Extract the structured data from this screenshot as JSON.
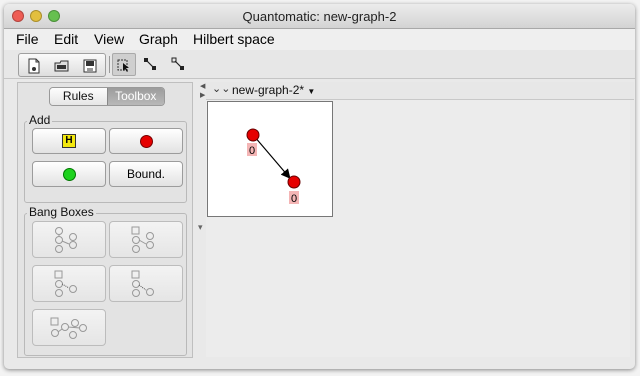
{
  "window": {
    "title": "Quantomatic: new-graph-2"
  },
  "menu": [
    "File",
    "Edit",
    "View",
    "Graph",
    "Hilbert space"
  ],
  "toolbar": {
    "icons": [
      "new-graph-icon",
      "open-icon",
      "save-icon",
      "select-tool-icon",
      "add-vertex-tool-icon",
      "add-edge-tool-icon"
    ]
  },
  "left_panel": {
    "tabs": [
      {
        "label": "Rules",
        "active": false
      },
      {
        "label": "Toolbox",
        "active": true
      }
    ],
    "add_group": {
      "label": "Add",
      "buttons": [
        {
          "icon": "hadamard-vertex-icon",
          "label": "H"
        },
        {
          "icon": "red-vertex-icon",
          "color": "#e60000"
        },
        {
          "icon": "green-vertex-icon",
          "color": "#1ed21e"
        },
        {
          "icon": "boundary-vertex-icon",
          "label": "Bound."
        }
      ]
    },
    "bang_group": {
      "label": "Bang Boxes",
      "buttons": [
        "bang-box-add-icon",
        "bang-box-remove-icon",
        "bang-box-drop-icon",
        "bang-box-kill-icon",
        "bang-box-duplicate-icon"
      ]
    }
  },
  "document": {
    "tab_label": "new-graph-2*",
    "graph": {
      "vertices": [
        {
          "id": "v1",
          "type": "red",
          "label": "0"
        },
        {
          "id": "v2",
          "type": "red",
          "label": "0"
        }
      ],
      "edges": [
        {
          "from": "v1",
          "to": "v2",
          "directed": true
        }
      ]
    }
  },
  "colors": {
    "red_vertex": "#e60000",
    "green_vertex": "#1ed21e",
    "label_bg": "#f4b5b5",
    "hadamard": "#f3e80e"
  }
}
